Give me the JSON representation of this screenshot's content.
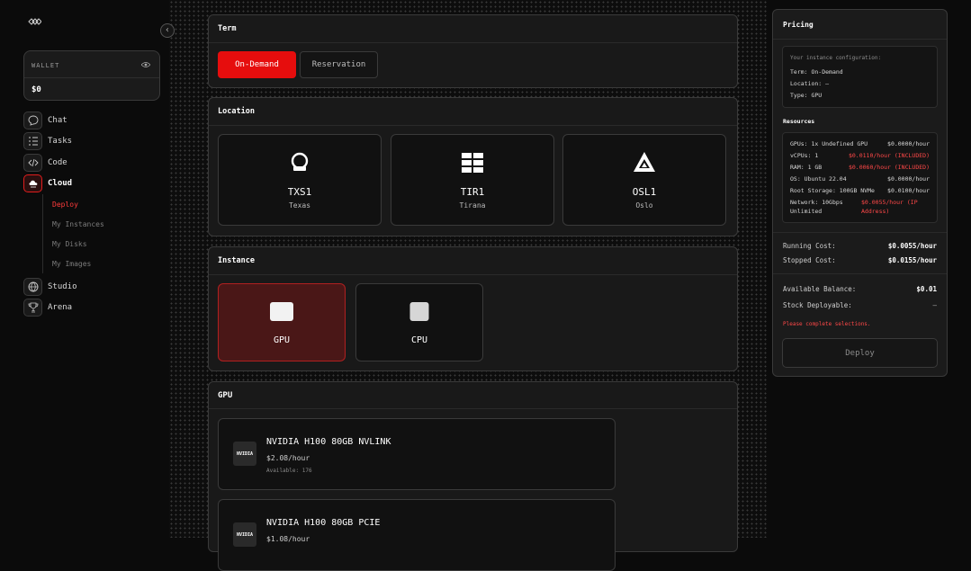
{
  "wallet": {
    "label": "WALLET",
    "value": "$0"
  },
  "nav": [
    {
      "label": "Chat",
      "icon": "chat-icon"
    },
    {
      "label": "Tasks",
      "icon": "tasks-icon"
    },
    {
      "label": "Code",
      "icon": "code-icon"
    },
    {
      "label": "Cloud",
      "icon": "cloud-icon"
    },
    {
      "label": "Studio",
      "icon": "globe-icon"
    },
    {
      "label": "Arena",
      "icon": "trophy-icon"
    }
  ],
  "cloud_sub": [
    "Deploy",
    "My Instances",
    "My Disks",
    "My Images"
  ],
  "term": {
    "title": "Term",
    "options": [
      "On-Demand",
      "Reservation"
    ],
    "selected": "On-Demand"
  },
  "location": {
    "title": "Location",
    "items": [
      {
        "code": "TXS1",
        "city": "Texas"
      },
      {
        "code": "TIR1",
        "city": "Tirana"
      },
      {
        "code": "OSL1",
        "city": "Oslo"
      }
    ]
  },
  "instance": {
    "title": "Instance",
    "options": [
      "GPU",
      "CPU"
    ],
    "selected": "GPU"
  },
  "gpu": {
    "title": "GPU",
    "items": [
      {
        "badge": "NVIDIA",
        "name": "NVIDIA H100 80GB NVLINK",
        "price": "$2.08/hour",
        "available": "Available: 176"
      },
      {
        "badge": "NVIDIA",
        "name": "NVIDIA H100 80GB PCIE",
        "price": "$1.08/hour",
        "available": ""
      }
    ]
  },
  "pricing": {
    "title": "Pricing",
    "config_header": "Your instance configuration:",
    "config": [
      "Term: On-Demand",
      "Location: –",
      "Type: GPU"
    ],
    "resources_title": "Resources",
    "resources": [
      {
        "label": "GPUs: 1x Undefined GPU",
        "price": "$0.0000/hour"
      },
      {
        "label": "vCPUs: 1",
        "price": "$0.0110/hour (INCLUDED)"
      },
      {
        "label": "RAM: 1 GB",
        "price": "$0.0060/hour (INCLUDED)"
      },
      {
        "label": "OS: Ubuntu 22.04",
        "price": "$0.0000/hour"
      },
      {
        "label": "Root Storage: 100GB NVMe",
        "price": "$0.0100/hour"
      },
      {
        "label": "Network: 10Gbps",
        "label2": "Unlimited",
        "price": "$0.0055/hour (IP",
        "price2": "Address)"
      }
    ],
    "running_cost_label": "Running Cost:",
    "running_cost": "$0.0055/hour",
    "stopped_cost_label": "Stopped Cost:",
    "stopped_cost": "$0.0155/hour",
    "balance_label": "Available Balance:",
    "balance": "$0.01",
    "stock_label": "Stock Deployable:",
    "stock": "—",
    "warning": "Please complete selections.",
    "deploy_label": "Deploy"
  }
}
